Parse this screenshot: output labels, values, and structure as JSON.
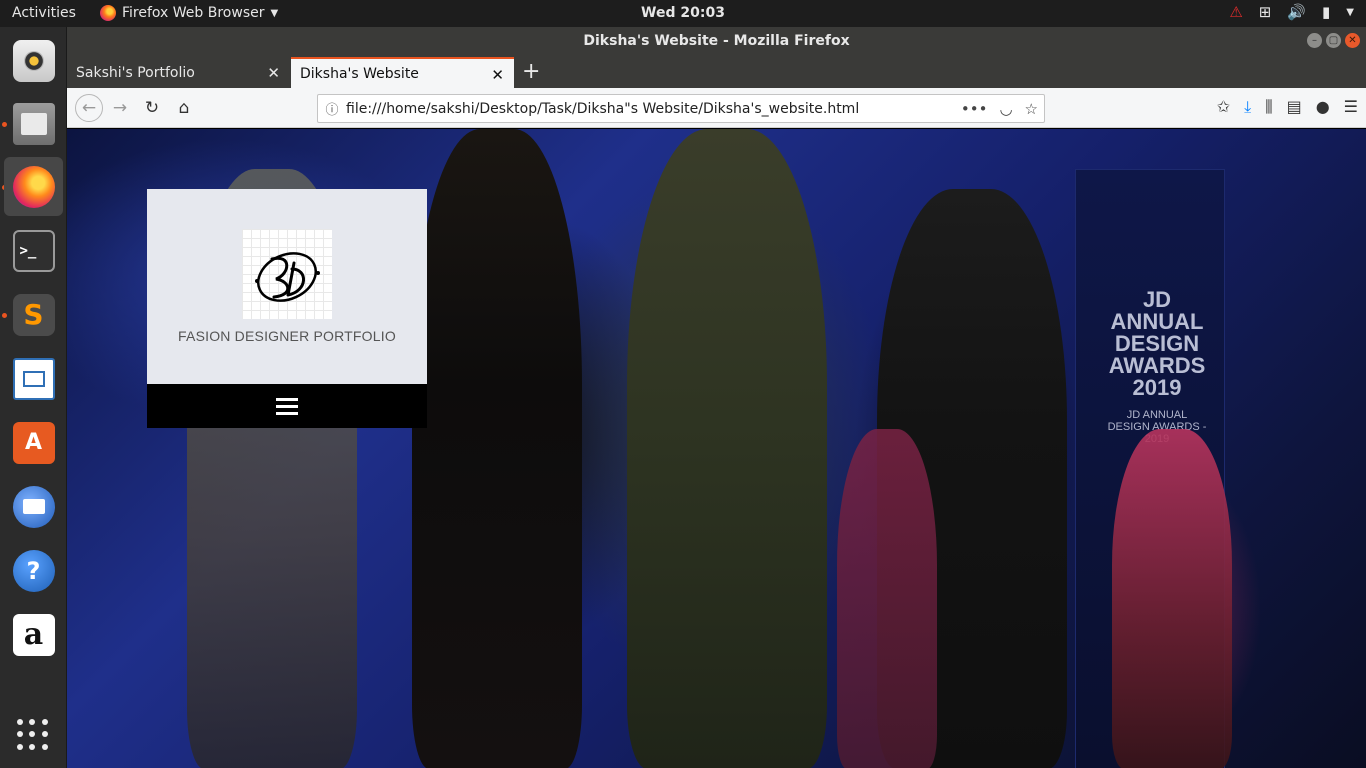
{
  "topbar": {
    "activities": "Activities",
    "app_name": "Firefox Web Browser",
    "clock": "Wed 20:03"
  },
  "dock": {
    "items": [
      "rhythmbox",
      "files",
      "firefox",
      "terminal",
      "sublime-text",
      "libreoffice-writer",
      "ubuntu-software",
      "thunderbird",
      "help",
      "amazon"
    ],
    "terminal_glyph": ">_",
    "sublime_glyph": "S",
    "software_glyph": "A",
    "help_glyph": "?",
    "amazon_glyph": "a"
  },
  "window": {
    "title": "Diksha's Website - Mozilla Firefox"
  },
  "tabs": [
    {
      "label": "Sakshi's Portfolio",
      "selected": false
    },
    {
      "label": "Diksha's Website",
      "selected": true
    }
  ],
  "navbar": {
    "url": "file:///home/sakshi/Desktop/Task/Diksha\"s Website/Diksha's_website.html"
  },
  "page": {
    "logo_monogram": "SD",
    "caption": "FASION DESIGNER PORTFOLIO",
    "backdrop_title": "JD ANNUAL DESIGN AWARDS 2019",
    "backdrop_subtitle": "JD ANNUAL DESIGN AWARDS - 2019"
  },
  "colors": {
    "accent": "#e95420",
    "card_bg": "#e6e8ee",
    "menu_bar": "#000000",
    "download_icon": "#0a84ff"
  }
}
